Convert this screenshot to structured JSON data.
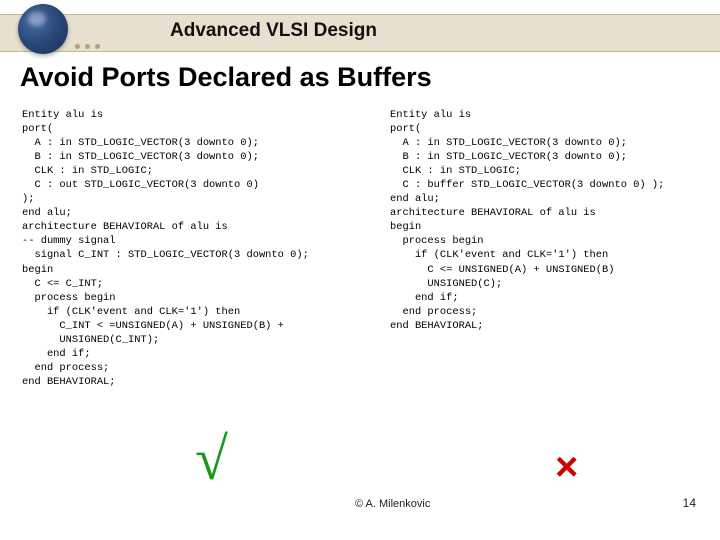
{
  "header": {
    "course_title": "Advanced VLSI Design"
  },
  "slide": {
    "title": "Avoid Ports Declared as Buffers"
  },
  "code": {
    "left": "Entity alu is\nport(\n  A : in STD_LOGIC_VECTOR(3 downto 0);\n  B : in STD_LOGIC_VECTOR(3 downto 0);\n  CLK : in STD_LOGIC;\n  C : out STD_LOGIC_VECTOR(3 downto 0)\n);\nend alu;\narchitecture BEHAVIORAL of alu is\n-- dummy signal\n  signal C_INT : STD_LOGIC_VECTOR(3 downto 0);\nbegin\n  C <= C_INT;\n  process begin\n    if (CLK'event and CLK='1') then\n      C_INT < =UNSIGNED(A) + UNSIGNED(B) +\n      UNSIGNED(C_INT);\n    end if;\n  end process;\nend BEHAVIORAL;",
    "right": "Entity alu is\nport(\n  A : in STD_LOGIC_VECTOR(3 downto 0);\n  B : in STD_LOGIC_VECTOR(3 downto 0);\n  CLK : in STD_LOGIC;\n  C : buffer STD_LOGIC_VECTOR(3 downto 0) );\nend alu;\narchitecture BEHAVIORAL of alu is\nbegin\n  process begin\n    if (CLK'event and CLK='1') then\n      C <= UNSIGNED(A) + UNSIGNED(B)\n      UNSIGNED(C);\n    end if;\n  end process;\nend BEHAVIORAL;"
  },
  "marks": {
    "check": "√",
    "cross": "×"
  },
  "footer": {
    "author": "© A. Milenkovic",
    "page": "14"
  }
}
